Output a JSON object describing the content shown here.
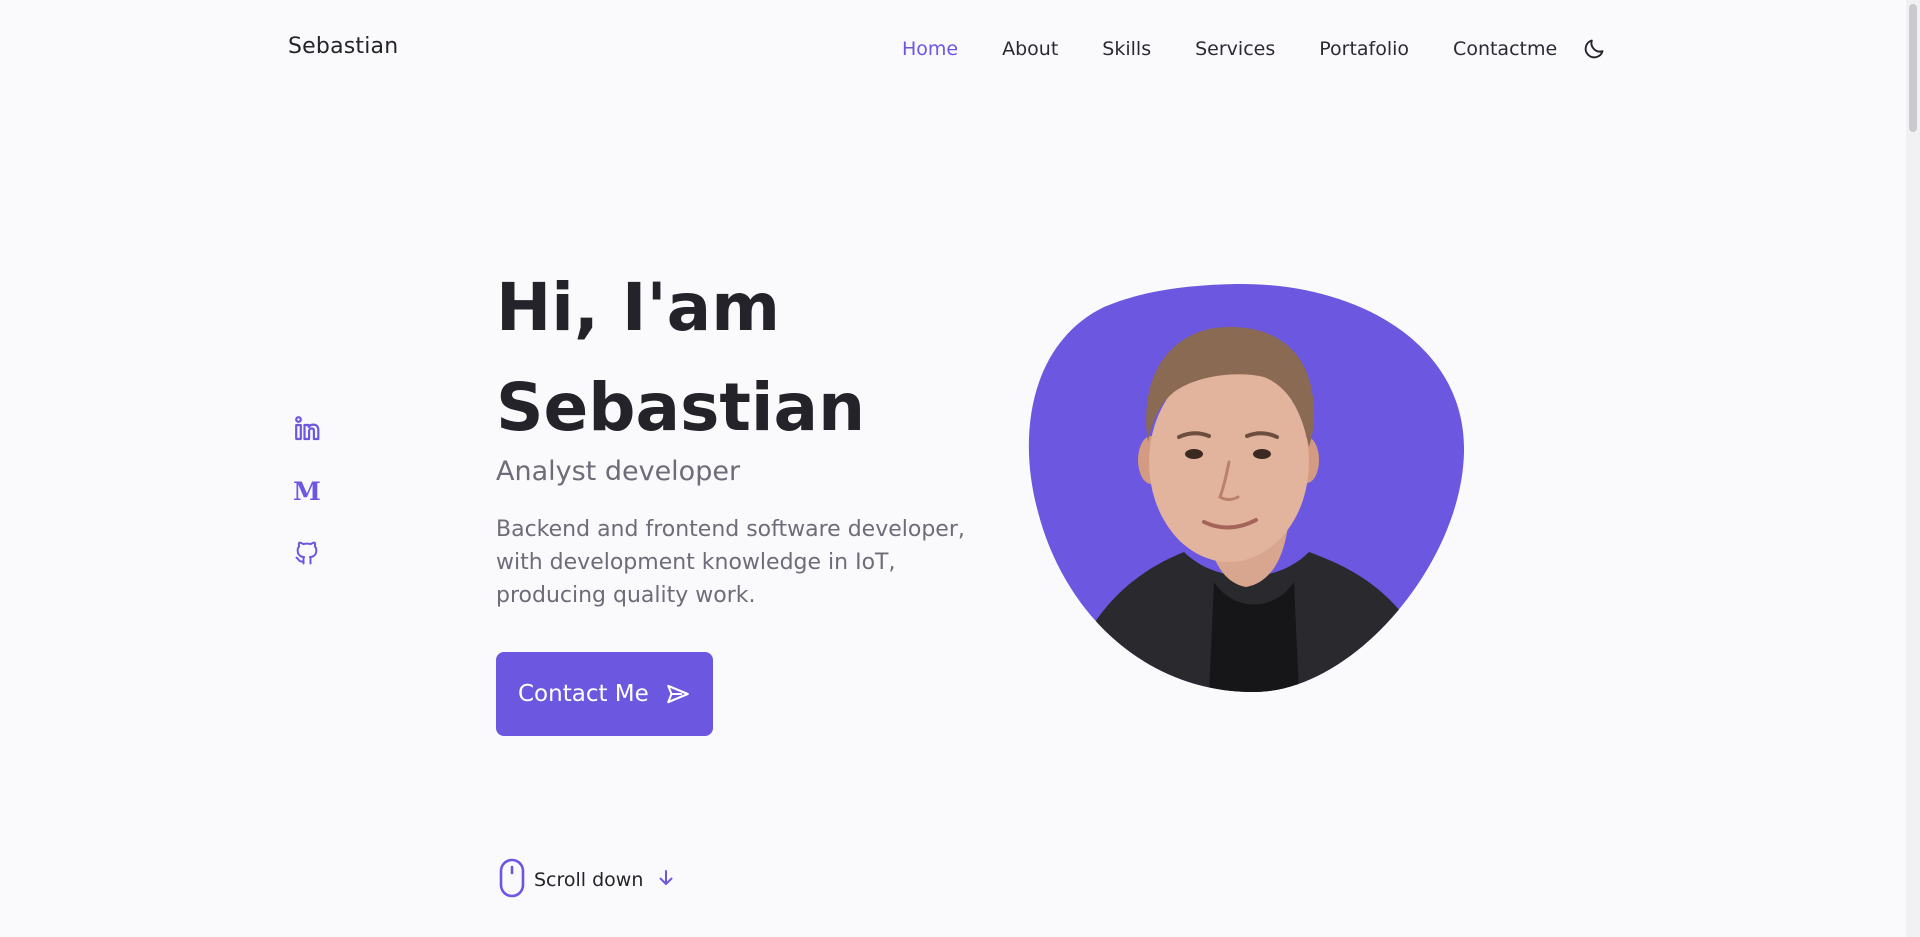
{
  "header": {
    "logo": "Sebastian",
    "nav": [
      {
        "label": "Home",
        "active": true
      },
      {
        "label": "About",
        "active": false
      },
      {
        "label": "Skills",
        "active": false
      },
      {
        "label": "Services",
        "active": false
      },
      {
        "label": "Portafolio",
        "active": false
      },
      {
        "label": "Contactme",
        "active": false
      }
    ],
    "theme_icon": "moon-icon"
  },
  "social": [
    {
      "icon": "linkedin-icon"
    },
    {
      "icon": "medium-icon",
      "glyph": "M"
    },
    {
      "icon": "github-icon"
    }
  ],
  "hero": {
    "title_line1": "Hi, I'am",
    "title_line2": "Sebastian",
    "subtitle": "Analyst developer",
    "description": "Backend and frontend software developer, with development knowledge in IoT, producing quality work.",
    "button_label": "Contact Me",
    "button_icon": "send-icon",
    "image": "profile-photo"
  },
  "scroll": {
    "label": "Scroll down",
    "icons": [
      "mouse-icon",
      "arrow-down-icon"
    ]
  },
  "colors": {
    "accent": "#6c57e0",
    "background": "#fafafc",
    "title": "#24232a",
    "text": "#6e6c79"
  }
}
